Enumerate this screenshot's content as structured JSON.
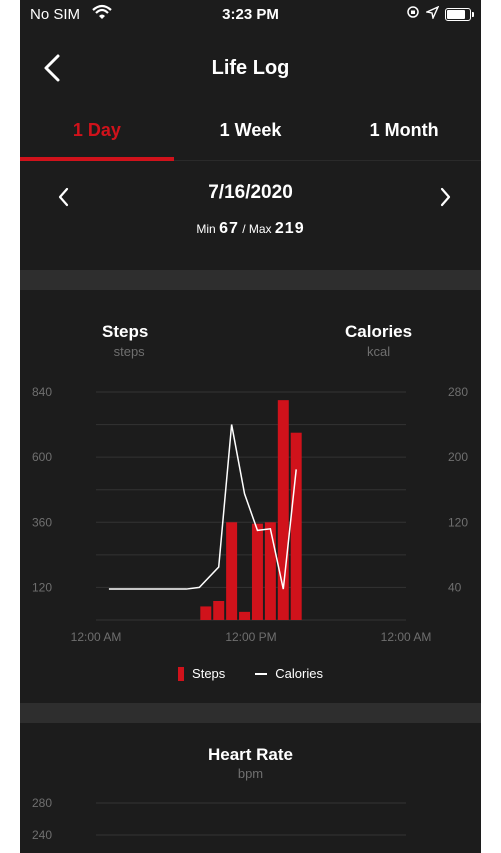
{
  "status_bar": {
    "carrier": "No SIM",
    "time": "3:23 PM"
  },
  "nav": {
    "title": "Life Log"
  },
  "tabs": [
    {
      "label": "1 Day",
      "active": true
    },
    {
      "label": "1 Week",
      "active": false
    },
    {
      "label": "1 Month",
      "active": false
    }
  ],
  "date": {
    "text": "7/16/2020",
    "min_label": "Min",
    "min_value": "67",
    "separator": "/",
    "max_label": "Max",
    "max_value": "219"
  },
  "colors": {
    "accent": "#d0121b",
    "background": "#1c1c1c",
    "muted": "#6f6f6f"
  },
  "steps_header": {
    "title": "Steps",
    "unit": "steps"
  },
  "calories_header": {
    "title": "Calories",
    "unit": "kcal"
  },
  "legend": {
    "steps": "Steps",
    "calories": "Calories"
  },
  "chart_data": {
    "type": "bar",
    "x_tick_labels": [
      "12:00 AM",
      "12:00 PM",
      "12:00 AM"
    ],
    "x_range_hours": [
      0,
      24
    ],
    "left_axis": {
      "unit": "steps",
      "ticks": [
        120,
        360,
        600,
        840
      ],
      "ylim": [
        0,
        840
      ]
    },
    "right_axis": {
      "unit": "kcal",
      "ticks": [
        40,
        120,
        200,
        280
      ],
      "ylim": [
        0,
        280
      ]
    },
    "grid": true,
    "series": [
      {
        "name": "Steps",
        "type": "bar",
        "axis": "left",
        "color": "#d0121b",
        "points": [
          {
            "hour": 8.5,
            "value": 50
          },
          {
            "hour": 9.5,
            "value": 70
          },
          {
            "hour": 10.5,
            "value": 360
          },
          {
            "hour": 11.5,
            "value": 30
          },
          {
            "hour": 12.5,
            "value": 355
          },
          {
            "hour": 13.5,
            "value": 360
          },
          {
            "hour": 14.5,
            "value": 810
          },
          {
            "hour": 15.5,
            "value": 690
          }
        ]
      },
      {
        "name": "Calories",
        "type": "line",
        "axis": "right",
        "color": "#ffffff",
        "points": [
          {
            "hour": 1.0,
            "value": 38
          },
          {
            "hour": 7.0,
            "value": 38
          },
          {
            "hour": 8.0,
            "value": 40
          },
          {
            "hour": 9.5,
            "value": 65
          },
          {
            "hour": 10.5,
            "value": 240
          },
          {
            "hour": 11.5,
            "value": 155
          },
          {
            "hour": 12.5,
            "value": 110
          },
          {
            "hour": 13.5,
            "value": 112
          },
          {
            "hour": 14.5,
            "value": 38
          },
          {
            "hour": 15.5,
            "value": 185
          }
        ]
      }
    ]
  },
  "heart_rate": {
    "title": "Heart Rate",
    "unit": "bpm",
    "y_ticks": [
      240,
      280
    ]
  }
}
